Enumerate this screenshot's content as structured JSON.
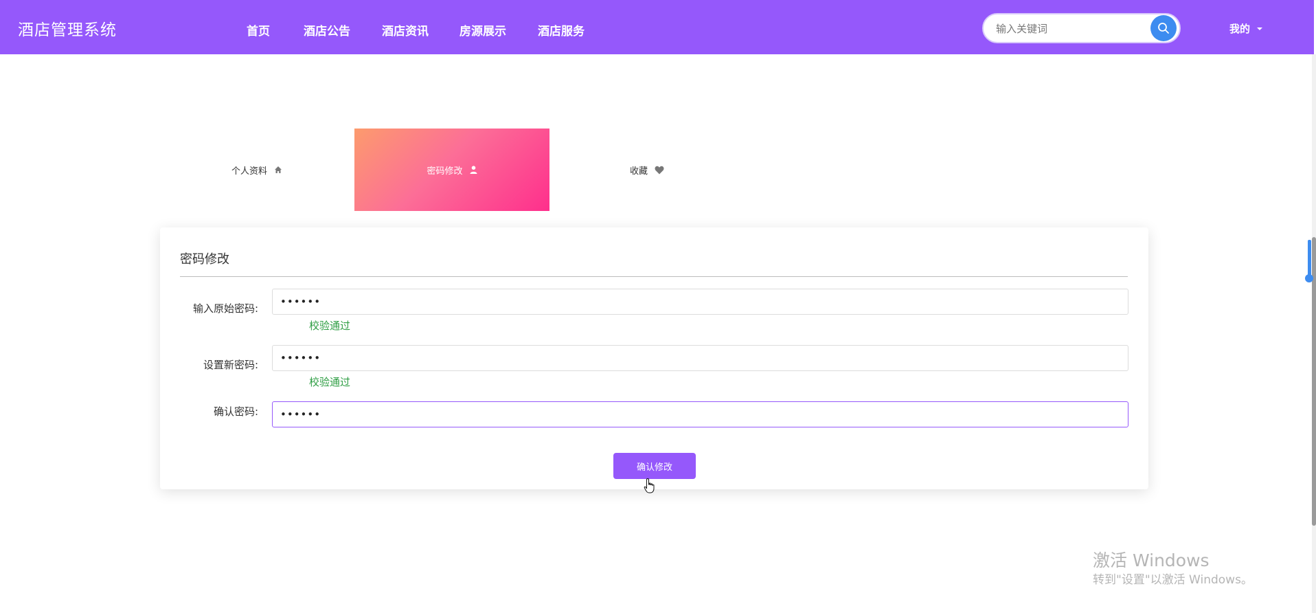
{
  "header": {
    "brand": "酒店管理系统",
    "nav": [
      "首页",
      "酒店公告",
      "酒店资讯",
      "房源展示",
      "酒店服务"
    ],
    "search_placeholder": "输入关键词",
    "user_menu_label": "我的"
  },
  "tabs": [
    {
      "label": "个人资料",
      "icon": "home-icon",
      "active": false
    },
    {
      "label": "密码修改",
      "icon": "user-icon",
      "active": true
    },
    {
      "label": "收藏",
      "icon": "heart-icon",
      "active": false
    }
  ],
  "form": {
    "title": "密码修改",
    "fields": [
      {
        "label": "输入原始密码:",
        "value": "••••••",
        "message": "校验通过"
      },
      {
        "label": "设置新密码:",
        "value": "••••••",
        "message": "校验通过"
      },
      {
        "label": "确认密码:",
        "value": "••••••",
        "message": ""
      }
    ],
    "submit_label": "确认修改"
  },
  "watermark": {
    "line1": "激活 Windows",
    "line2": "转到\"设置\"以激活 Windows。"
  },
  "colors": {
    "accent": "#9558fb",
    "search_button": "#3d8cf0",
    "valid": "#2f9e44"
  }
}
